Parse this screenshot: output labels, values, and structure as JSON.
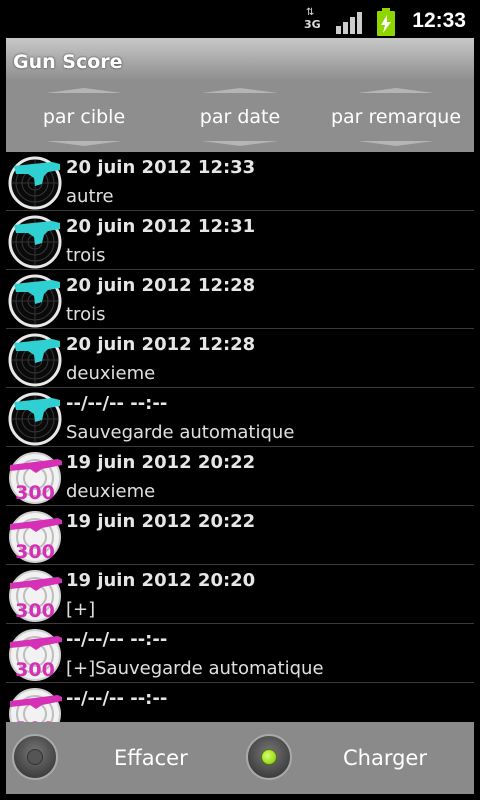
{
  "status": {
    "network": "3G",
    "time": "12:33"
  },
  "app": {
    "title": "Gun Score"
  },
  "sort": {
    "by_target": "par cible",
    "by_date": "par date",
    "by_note": "par remarque"
  },
  "items": [
    {
      "date": "20 juin 2012 12:33",
      "note": "autre",
      "target": "pistol"
    },
    {
      "date": "20 juin 2012 12:31",
      "note": "trois",
      "target": "pistol"
    },
    {
      "date": "20 juin 2012 12:28",
      "note": "trois",
      "target": "pistol"
    },
    {
      "date": "20 juin 2012 12:28",
      "note": "deuxieme",
      "target": "pistol"
    },
    {
      "date": "--/--/-- --:--",
      "note": "Sauvegarde automatique",
      "target": "pistol"
    },
    {
      "date": "19 juin 2012 20:22",
      "note": "deuxieme",
      "target": "rifle-300"
    },
    {
      "date": "19 juin 2012 20:22",
      "note": "",
      "target": "rifle-300"
    },
    {
      "date": "19 juin 2012 20:20",
      "note": "[+]",
      "target": "rifle-300"
    },
    {
      "date": "--/--/-- --:--",
      "note": "[+]Sauvegarde automatique",
      "target": "rifle-300"
    },
    {
      "date": "--/--/-- --:--",
      "note": "",
      "target": "rifle-300"
    }
  ],
  "thumb_label_300": "300",
  "bottom": {
    "delete_label": "Effacer",
    "load_label": "Charger",
    "load_selected": true
  }
}
